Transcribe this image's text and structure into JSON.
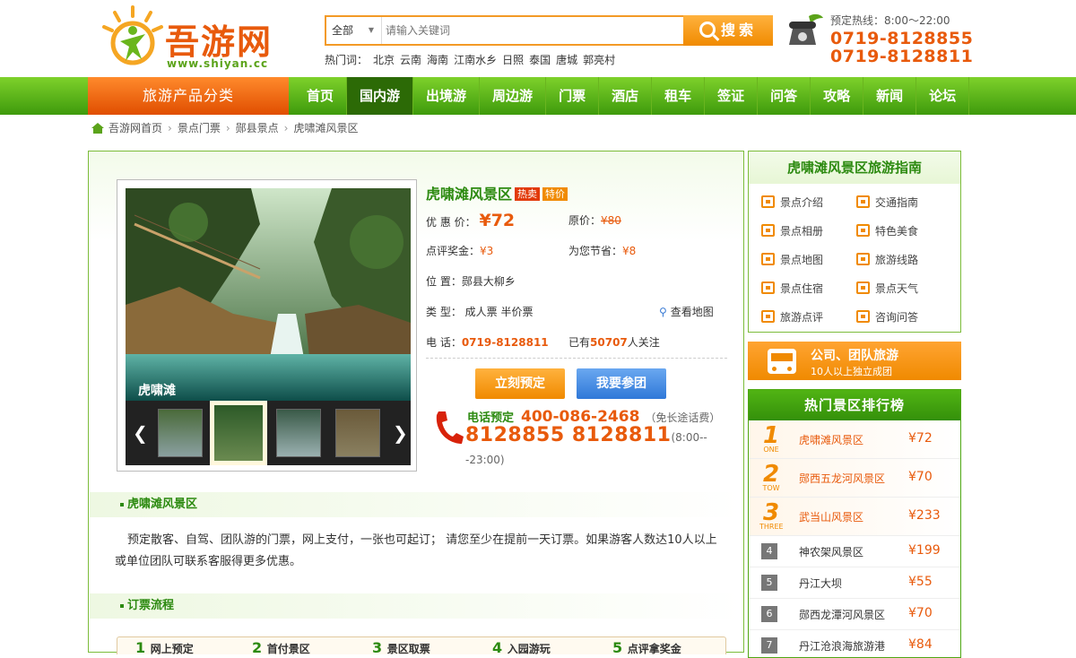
{
  "header": {
    "logo_text": "吾游网",
    "logo_url": "www.shiyan.cc",
    "search": {
      "category": "全部",
      "placeholder": "请输入关键词",
      "button": "搜索"
    },
    "hot_label": "热门词：",
    "hot_words": [
      "北京",
      "云南",
      "海南",
      "江南水乡",
      "日照",
      "泰国",
      "唐城",
      "郭亮村"
    ],
    "hotline_label": "预定热线：8:00～22:00",
    "hotline_1": "0719-8128855",
    "hotline_2": "0719-8128811"
  },
  "nav": {
    "category_label": "旅游产品分类",
    "items": [
      "首页",
      "国内游",
      "出境游",
      "周边游",
      "门票",
      "酒店",
      "租车",
      "签证",
      "问答",
      "攻略",
      "新闻",
      "论坛"
    ],
    "active": "国内游"
  },
  "breadcrumb": [
    "吾游网首页",
    "景点门票",
    "郧县景点",
    "虎啸滩风景区"
  ],
  "product": {
    "image_caption": "虎啸滩",
    "title": "虎啸滩风景区",
    "tag_hot": "热卖",
    "tag_special": "特价",
    "price_label": "优 惠 价：",
    "price_value": "¥72",
    "orig_label": "原价：",
    "orig_value": "¥80",
    "reward_label": "点评奖金：",
    "reward_value": "¥3",
    "save_label": "为您节省：",
    "save_value": "¥8",
    "location_label": "位  置：",
    "location_value": "郧县大柳乡",
    "type_label": "类  型：",
    "type_value": "成人票 半价票",
    "map_link": "查看地图",
    "phone_label": "电  话：",
    "phone_value": "0719-8128811",
    "follow_prefix": "已有",
    "follow_count": "50707",
    "follow_suffix": "人关注",
    "book_button": "立刻预定",
    "join_button": "我要参团",
    "tel_label": "电话预定",
    "tel_free": "400-086-2468",
    "tel_free_note": "（免长途话费）",
    "tel_local": "8128855  8128811",
    "tel_hours": "(8:00---23:00)"
  },
  "section1": {
    "title": "虎啸滩风景区",
    "text": "预定散客、自驾、团队游的门票，网上支付，一张也可起订； 请您至少在提前一天订票。如果游客人数达10人以上或单位团队可联系客服得更多优惠。"
  },
  "section2": {
    "title": "订票流程"
  },
  "flow_steps": [
    "网上预定",
    "首付景区",
    "景区取票",
    "入园游玩",
    "点评拿奖金"
  ],
  "guide": {
    "title": "虎啸滩风景区旅游指南",
    "items": [
      "景点介绍",
      "交通指南",
      "景点相册",
      "特色美食",
      "景点地图",
      "旅游线路",
      "景点住宿",
      "景点天气",
      "旅游点评",
      "咨询问答"
    ]
  },
  "team": {
    "title": "公司、团队旅游",
    "sub": "10人以上独立成团"
  },
  "rank": {
    "title": "热门景区排行榜",
    "items": [
      {
        "no": "1",
        "en": "ONE",
        "name": "虎啸滩风景区",
        "price": "¥72"
      },
      {
        "no": "2",
        "en": "TOW",
        "name": "郧西五龙河风景区",
        "price": "¥70"
      },
      {
        "no": "3",
        "en": "THREE",
        "name": "武当山风景区",
        "price": "¥233"
      },
      {
        "no": "4",
        "name": "神农架风景区",
        "price": "¥199"
      },
      {
        "no": "5",
        "name": "丹江大坝",
        "price": "¥55"
      },
      {
        "no": "6",
        "name": "郧西龙潭河风景区",
        "price": "¥70"
      },
      {
        "no": "7",
        "name": "丹江沧浪海旅游港",
        "price": "¥84"
      }
    ]
  },
  "colors": {
    "green": "#3e9a0c",
    "orange": "#e85a0c",
    "accent": "#f08a00"
  }
}
